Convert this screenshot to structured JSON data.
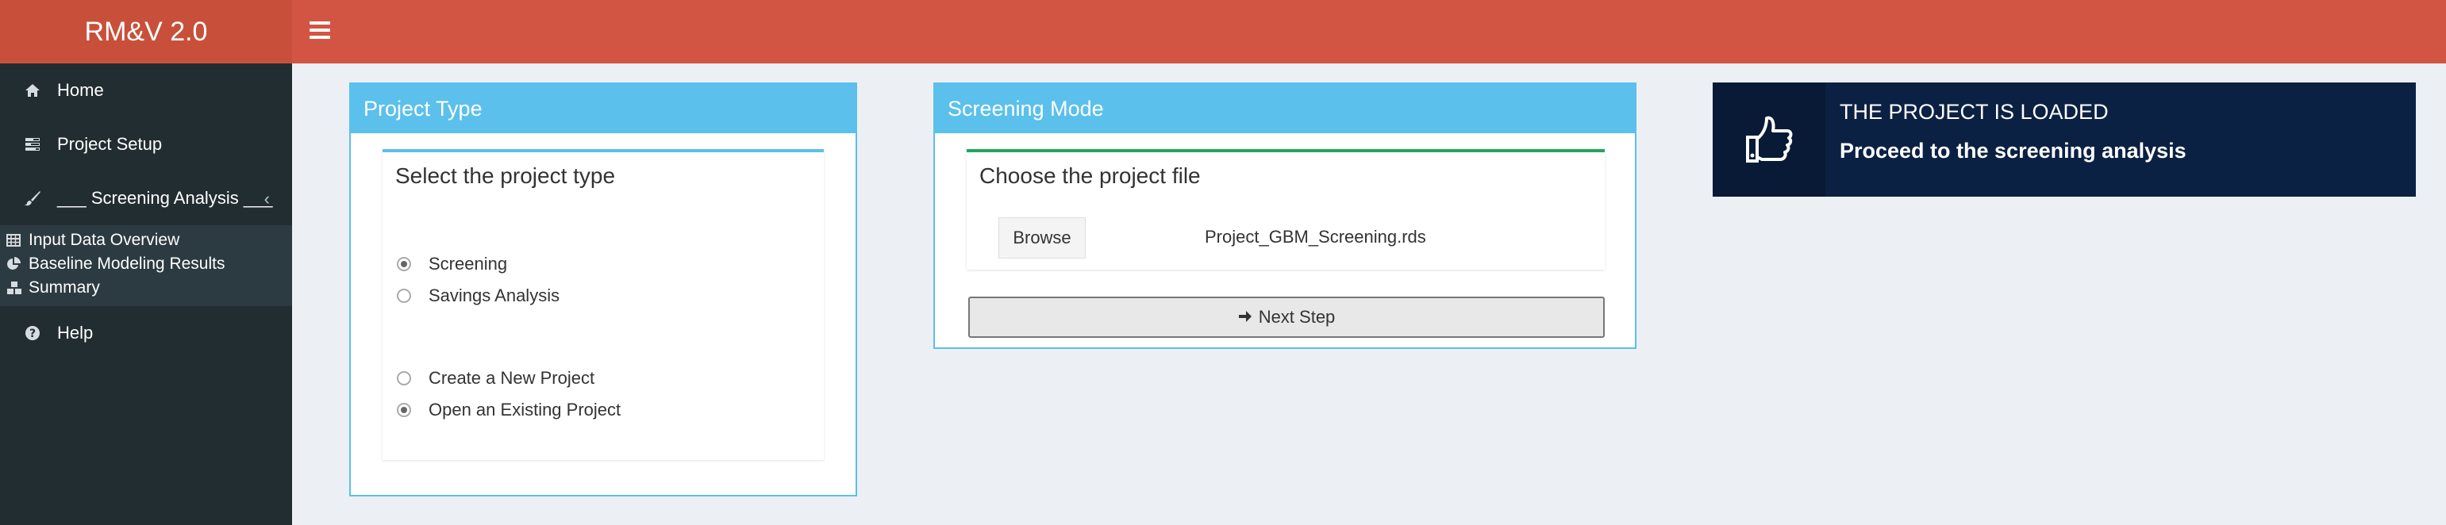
{
  "app": {
    "title": "RM&V 2.0"
  },
  "sidebar": {
    "items": [
      {
        "label": "Home",
        "icon": "home-icon"
      },
      {
        "label": "Project Setup",
        "icon": "tasks-icon"
      },
      {
        "label": "___ Screening Analysis ___",
        "icon": "paint-brush-icon"
      }
    ],
    "submenu": [
      {
        "label": "Input Data Overview",
        "icon": "table-icon"
      },
      {
        "label": "Baseline Modeling Results",
        "icon": "pie-chart-icon"
      },
      {
        "label": "Summary",
        "icon": "cubes-icon"
      }
    ],
    "help": {
      "label": "Help",
      "icon": "question-circle-icon"
    }
  },
  "project_type": {
    "header": "Project Type",
    "title": "Select the project type",
    "options_type": [
      {
        "label": "Screening",
        "checked": true
      },
      {
        "label": "Savings Analysis",
        "checked": false
      }
    ],
    "options_mode": [
      {
        "label": "Create a New Project",
        "checked": false
      },
      {
        "label": "Open an Existing Project",
        "checked": true
      }
    ]
  },
  "screening_mode": {
    "header": "Screening Mode",
    "title": "Choose the project file",
    "browse_label": "Browse",
    "file_name": "Project_GBM_Screening.rds",
    "next_label": "Next Step"
  },
  "infobox": {
    "line1": "THE PROJECT IS LOADED",
    "line2": "Proceed to the screening analysis",
    "icon": "thumbs-up-icon"
  },
  "colors": {
    "header": "#d25543",
    "logo": "#c8503a",
    "sidebar": "#222d32",
    "box_accent": "#5bc0eb",
    "success": "#22a55a",
    "infobox": "#0b2143"
  }
}
